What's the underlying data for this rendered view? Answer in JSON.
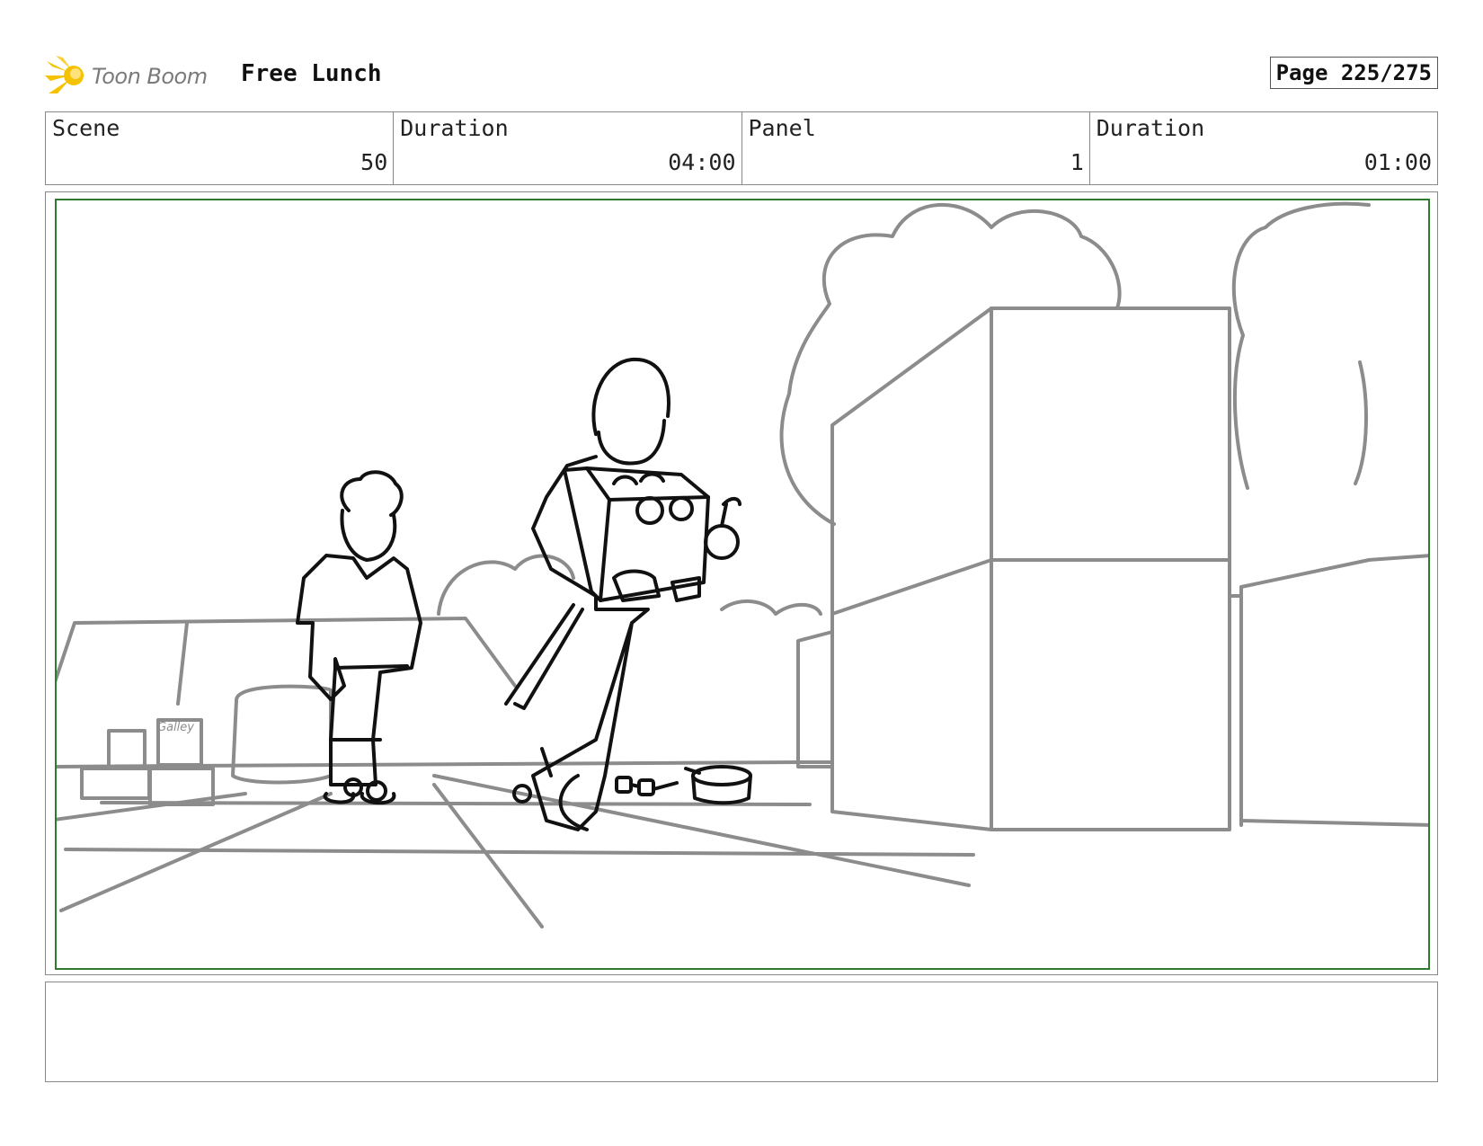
{
  "header": {
    "logo_text": "Toon Boom",
    "logo_icon": "starburst-logo-icon",
    "project_title": "Free Lunch",
    "page_label": "Page 225/275"
  },
  "info": {
    "scene_label": "Scene",
    "scene_value": "50",
    "scene_duration_label": "Duration",
    "scene_duration_value": "04:00",
    "panel_label": "Panel",
    "panel_value": "1",
    "panel_duration_label": "Duration",
    "panel_duration_value": "01:00"
  },
  "drawing": {
    "bag_label": "Galley"
  },
  "notes": {
    "text": ""
  },
  "colors": {
    "frame_green": "#2f7a2f",
    "sketch_gray": "#8c8c8c",
    "ink_black": "#111111",
    "logo_yellow": "#f5c200"
  }
}
